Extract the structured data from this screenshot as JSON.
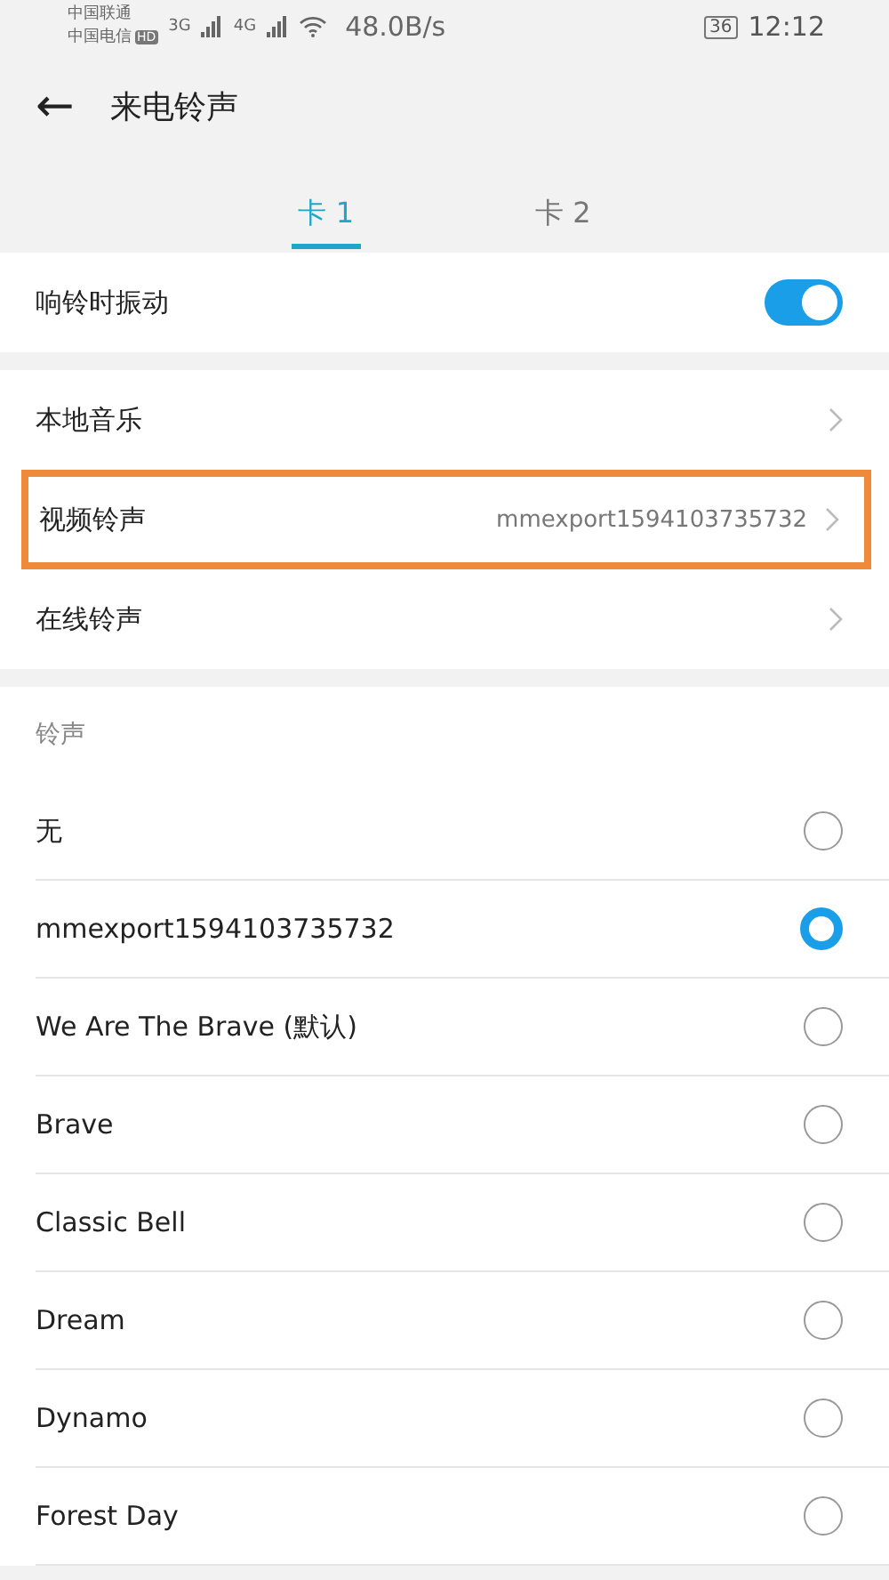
{
  "status_bar": {
    "carriers": [
      "中国联通",
      "中国电信"
    ],
    "hd_badge": "HD",
    "networks": [
      "3G",
      "4G"
    ],
    "speed": "48.0B/s",
    "battery": "36",
    "time": "12:12"
  },
  "header": {
    "back": "←",
    "title": "来电铃声"
  },
  "tabs": [
    {
      "label": "卡 1",
      "selected": true
    },
    {
      "label": "卡 2",
      "selected": false
    }
  ],
  "vibrate": {
    "label": "响铃时振动",
    "on": true
  },
  "sources": [
    {
      "label": "本地音乐",
      "highlighted": false
    },
    {
      "label": "视频铃声",
      "value": "mmexport1594103735732",
      "highlighted": true
    },
    {
      "label": "在线铃声",
      "highlighted": false
    }
  ],
  "ringtones": {
    "heading": "铃声",
    "items": [
      {
        "label": "无",
        "selected": false
      },
      {
        "label": "mmexport1594103735732",
        "selected": true
      },
      {
        "label": "We Are The Brave (默认)",
        "selected": false
      },
      {
        "label": "Brave",
        "selected": false
      },
      {
        "label": "Classic Bell",
        "selected": false
      },
      {
        "label": "Dream",
        "selected": false
      },
      {
        "label": "Dynamo",
        "selected": false
      },
      {
        "label": "Forest Day",
        "selected": false
      }
    ]
  }
}
